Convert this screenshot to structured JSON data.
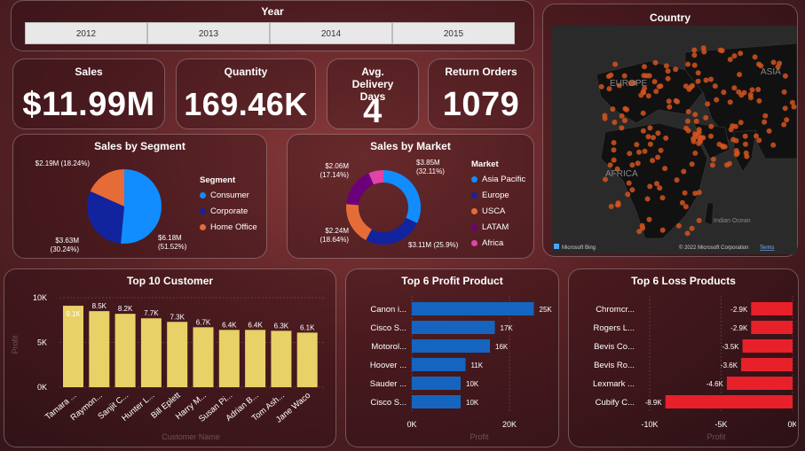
{
  "slicer": {
    "title": "Year",
    "years": [
      "2012",
      "2013",
      "2014",
      "2015"
    ]
  },
  "kpis": {
    "sales": {
      "title": "Sales",
      "value": "$11.99M"
    },
    "quantity": {
      "title": "Quantity",
      "value": "169.46K"
    },
    "delivery": {
      "title": "Avg. Delivery Days",
      "value": "4"
    },
    "returns": {
      "title": "Return Orders",
      "value": "1079"
    }
  },
  "map": {
    "title": "Country",
    "labels": [
      "EUROPE",
      "ASIA",
      "AFRICA",
      "Indian Ocean"
    ],
    "bing": "Microsoft Bing",
    "copyright": "© 2022 Microsoft Corporation",
    "terms": "Terms"
  },
  "colors": {
    "blue": "#118DFF",
    "navy": "#12239E",
    "orange": "#E66C37",
    "purple": "#6B007B",
    "pink": "#E044A7",
    "bar_yellow": "#E8D166",
    "bar_blue": "#1565C0",
    "bar_red": "#E8202A"
  },
  "chart_data": [
    {
      "id": "segment",
      "type": "pie",
      "title": "Sales by Segment",
      "legend_title": "Segment",
      "categories": [
        "Consumer",
        "Corporate",
        "Home Office"
      ],
      "values": [
        6.18,
        3.63,
        2.19
      ],
      "percents": [
        51.52,
        30.24,
        18.24
      ],
      "labels": [
        "$6.18M (51.52%)",
        "$3.63M (30.24%)",
        "$2.19M (18.24%)"
      ]
    },
    {
      "id": "market",
      "type": "pie",
      "title": "Sales by Market",
      "legend_title": "Market",
      "categories": [
        "Asia Pacific",
        "Europe",
        "USCA",
        "LATAM",
        "Africa"
      ],
      "values": [
        3.85,
        3.11,
        2.24,
        2.06,
        0.78
      ],
      "percents": [
        32.11,
        25.9,
        18.64,
        17.14,
        6.21
      ],
      "labels": [
        "$3.85M (32.11%)",
        "$3.11M (25.9%)",
        "$2.24M (18.64%)",
        "$2.06M (17.14%)",
        ""
      ]
    },
    {
      "id": "customers",
      "type": "bar",
      "title": "Top 10 Customer",
      "xlabel": "Customer Name",
      "ylabel": "Profit",
      "categories": [
        "Tamara ...",
        "Raymon...",
        "Sanjit C...",
        "Hunter L...",
        "Bill Eplett",
        "Harry M...",
        "Susan Pi...",
        "Adrian B...",
        "Tom Ash...",
        "Jane Waco"
      ],
      "values": [
        9.1,
        8.5,
        8.2,
        7.7,
        7.3,
        6.7,
        6.4,
        6.4,
        6.3,
        6.1
      ],
      "value_labels": [
        "9.1K",
        "8.5K",
        "8.2K",
        "7.7K",
        "7.3K",
        "6.7K",
        "6.4K",
        "6.4K",
        "6.3K",
        "6.1K"
      ],
      "yticks": [
        "0K",
        "5K",
        "10K"
      ],
      "ylim": [
        0,
        10
      ]
    },
    {
      "id": "profit_products",
      "type": "bar",
      "orientation": "horizontal",
      "title": "Top 6 Profit Product",
      "xlabel": "Profit",
      "categories": [
        "Canon i...",
        "Cisco S...",
        "Motorol...",
        "Hoover ...",
        "Sauder ...",
        "Cisco S..."
      ],
      "values": [
        25,
        17,
        16,
        11,
        10,
        10
      ],
      "value_labels": [
        "25K",
        "17K",
        "16K",
        "11K",
        "10K",
        "10K"
      ],
      "xticks": [
        "0K",
        "20K"
      ],
      "xlim": [
        0,
        30
      ]
    },
    {
      "id": "loss_products",
      "type": "bar",
      "orientation": "horizontal",
      "title": "Top 6 Loss Products",
      "xlabel": "Profit",
      "categories": [
        "Chromcr...",
        "Rogers L...",
        "Bevis Co...",
        "Bevis Ro...",
        "Lexmark ...",
        "Cubify C..."
      ],
      "values": [
        -2.9,
        -2.9,
        -3.5,
        -3.6,
        -4.6,
        -8.9
      ],
      "value_labels": [
        "-2.9K",
        "-2.9K",
        "-3.5K",
        "-3.6K",
        "-4.6K",
        "-8.9K"
      ],
      "xticks": [
        "-10K",
        "-5K",
        "0K"
      ],
      "xlim": [
        -10,
        0
      ]
    }
  ]
}
